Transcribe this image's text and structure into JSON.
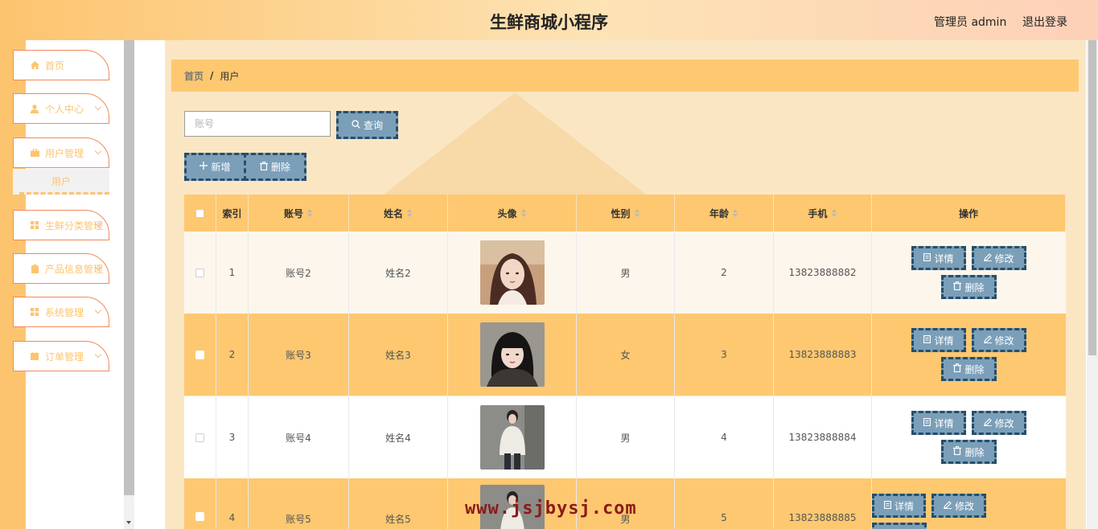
{
  "header": {
    "title": "生鲜商城小程序",
    "admin_label": "管理员 admin",
    "logout_label": "退出登录"
  },
  "sidebar": {
    "items": [
      {
        "label": "首页",
        "icon": "home-icon"
      },
      {
        "label": "个人中心",
        "icon": "user-icon"
      },
      {
        "label": "用户管理",
        "icon": "briefcase-icon"
      },
      {
        "label": "生鲜分类管理",
        "icon": "grid-icon"
      },
      {
        "label": "产品信息管理",
        "icon": "clipboard-icon"
      },
      {
        "label": "系统管理",
        "icon": "grid-icon"
      },
      {
        "label": "订单管理",
        "icon": "calendar-icon"
      }
    ],
    "sub_item": "用户"
  },
  "breadcrumb": {
    "home": "首页",
    "separator": "/",
    "current": "用户"
  },
  "search": {
    "placeholder": "账号",
    "button": "查询"
  },
  "actions": {
    "add": "新增",
    "delete": "删除"
  },
  "table": {
    "columns": [
      "索引",
      "账号",
      "姓名",
      "头像",
      "性别",
      "年龄",
      "手机",
      "操作"
    ],
    "rows": [
      {
        "index": "1",
        "account": "账号2",
        "name": "姓名2",
        "gender": "男",
        "age": "2",
        "phone": "13823888882"
      },
      {
        "index": "2",
        "account": "账号3",
        "name": "姓名3",
        "gender": "女",
        "age": "3",
        "phone": "13823888883"
      },
      {
        "index": "3",
        "account": "账号4",
        "name": "姓名4",
        "gender": "男",
        "age": "4",
        "phone": "13823888884"
      },
      {
        "index": "4",
        "account": "账号5",
        "name": "姓名5",
        "gender": "男",
        "age": "5",
        "phone": "13823888885"
      }
    ],
    "op_labels": {
      "detail": "详情",
      "edit": "修改",
      "delete": "删除"
    }
  },
  "watermark": "www.jsjbysj.com",
  "colors": {
    "accent": "#fdc870",
    "button": "#7b9fb8",
    "button_border": "#274e6a",
    "menu_border": "#f08a5a"
  }
}
